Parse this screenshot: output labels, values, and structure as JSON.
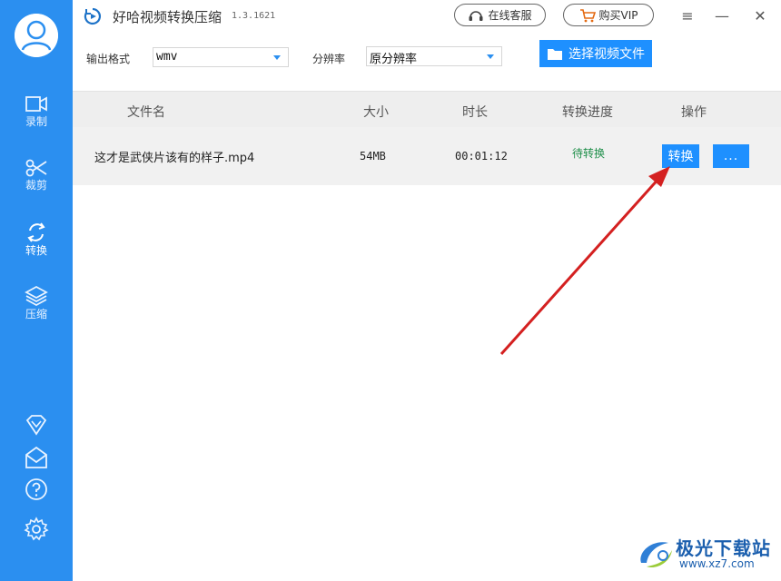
{
  "app": {
    "title": "好哈视频转换压缩",
    "version": "1.3.1621"
  },
  "titlebar": {
    "service_label": "在线客服",
    "vip_label": "购买VIP",
    "menu_glyph": "≡",
    "minimize_glyph": "—",
    "close_glyph": "✕"
  },
  "sidebar": {
    "items": [
      {
        "label": "录制",
        "icon": "video-camera-icon"
      },
      {
        "label": "裁剪",
        "icon": "scissors-icon"
      },
      {
        "label": "转换",
        "icon": "refresh-icon",
        "active": true
      },
      {
        "label": "压缩",
        "icon": "layers-icon"
      }
    ],
    "bottom_icons": [
      "diamond-icon",
      "mail-icon",
      "help-icon",
      "settings-icon"
    ]
  },
  "options": {
    "format_label": "输出格式",
    "format_value": "wmv",
    "resolution_label": "分辨率",
    "resolution_value": "原分辨率",
    "choose_file_label": "选择视频文件"
  },
  "table": {
    "columns": [
      "文件名",
      "大小",
      "时长",
      "转换进度",
      "操作"
    ],
    "rows": [
      {
        "name": "这才是武侠片该有的样子.mp4",
        "size": "54MB",
        "duration": "00:01:12",
        "status": "待转换",
        "convert_label": "转换",
        "more_label": "..."
      }
    ]
  },
  "watermark": {
    "brand": "极光下载站",
    "url": "www.xz7.com"
  },
  "colors": {
    "sidebar": "#2b8ff0",
    "primary_button": "#1e90ff",
    "status": "#1f8f4a",
    "arrow": "#d42020"
  }
}
